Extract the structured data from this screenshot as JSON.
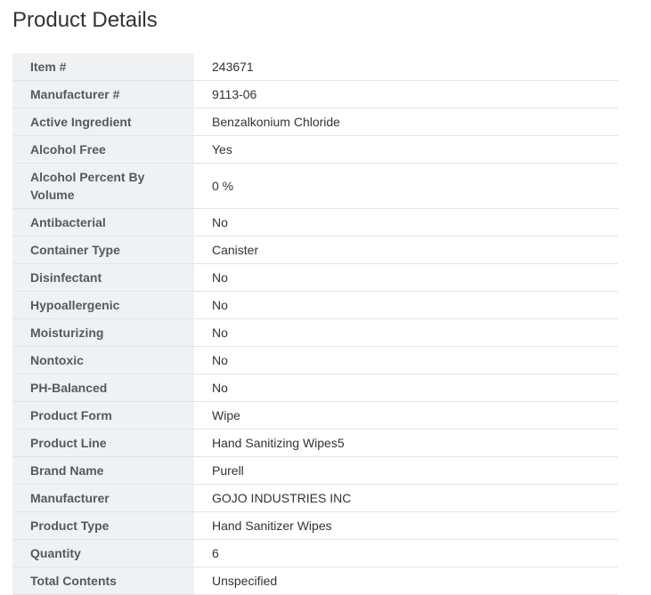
{
  "page": {
    "title": "Product Details"
  },
  "details": [
    {
      "label": "Item #",
      "value": "243671"
    },
    {
      "label": "Manufacturer #",
      "value": "9113-06"
    },
    {
      "label": "Active Ingredient",
      "value": "Benzalkonium Chloride"
    },
    {
      "label": "Alcohol Free",
      "value": "Yes"
    },
    {
      "label": "Alcohol Percent By Volume",
      "value": "0 %"
    },
    {
      "label": "Antibacterial",
      "value": "No"
    },
    {
      "label": "Container Type",
      "value": "Canister"
    },
    {
      "label": "Disinfectant",
      "value": "No"
    },
    {
      "label": "Hypoallergenic",
      "value": "No"
    },
    {
      "label": "Moisturizing",
      "value": "No"
    },
    {
      "label": "Nontoxic",
      "value": "No"
    },
    {
      "label": "PH-Balanced",
      "value": "No"
    },
    {
      "label": "Product Form",
      "value": "Wipe"
    },
    {
      "label": "Product Line",
      "value": "Hand Sanitizing Wipes5"
    },
    {
      "label": "Brand Name",
      "value": "Purell"
    },
    {
      "label": "Manufacturer",
      "value": "GOJO INDUSTRIES INC"
    },
    {
      "label": "Product Type",
      "value": "Hand Sanitizer Wipes"
    },
    {
      "label": "Quantity",
      "value": "6"
    },
    {
      "label": "Total Contents",
      "value": "Unspecified"
    }
  ]
}
